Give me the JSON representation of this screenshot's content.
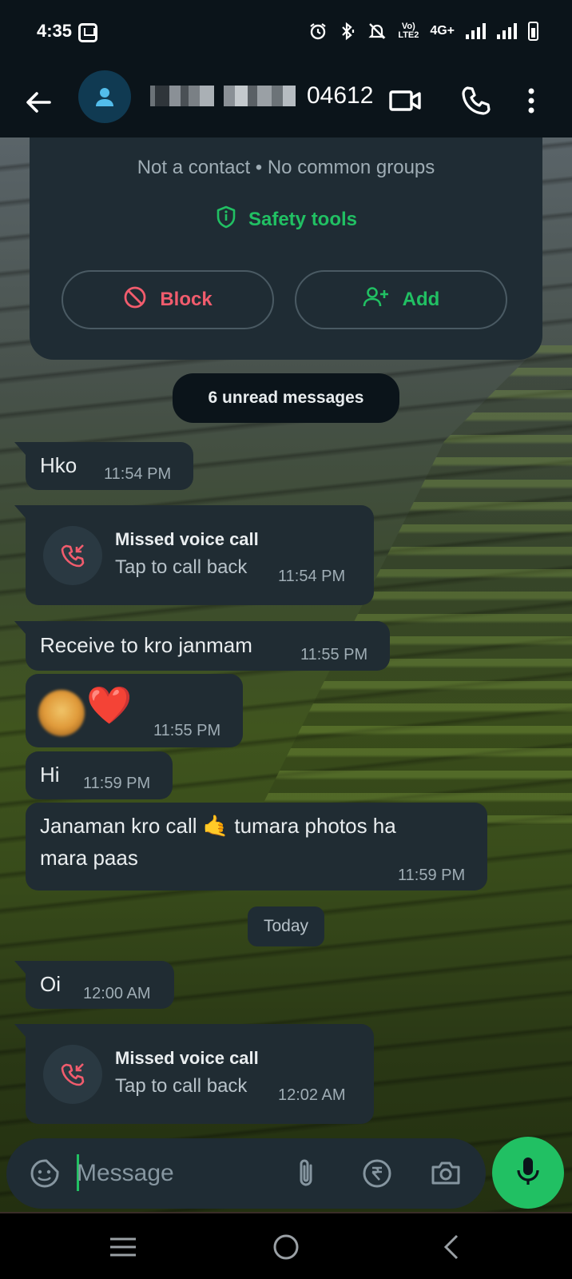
{
  "status_bar": {
    "time": "4:35",
    "network": "4G+",
    "volte": "Vo) LTE2"
  },
  "header": {
    "contact_number_suffix": "04612",
    "contact_number_masked": true
  },
  "contact_card": {
    "subtitle": "Not a contact • No common groups",
    "safety_tools_label": "Safety tools",
    "block_label": "Block",
    "add_label": "Add"
  },
  "unread_chip": "6 unread messages",
  "date_chip": "Today",
  "messages": [
    {
      "type": "text",
      "text": "Hko",
      "time": "11:54 PM"
    },
    {
      "type": "missed_call",
      "title": "Missed voice call",
      "subtitle": "Tap to call back",
      "time": "11:54 PM"
    },
    {
      "type": "text",
      "text": "Receive to kro janmam",
      "time": "11:55 PM"
    },
    {
      "type": "emoji",
      "text": "❤️",
      "time": "11:55 PM"
    },
    {
      "type": "text",
      "text": "Hi",
      "time": "11:59 PM"
    },
    {
      "type": "text",
      "line1": "Janaman kro call 🤙 tumara photos ha",
      "line2": "mara paas",
      "time": "11:59 PM"
    },
    {
      "type": "text",
      "text": "Oi",
      "time": "12:00 AM"
    },
    {
      "type": "missed_call",
      "title": "Missed voice call",
      "subtitle": "Tap to call back",
      "time": "12:02 AM"
    }
  ],
  "composer": {
    "placeholder": "Message"
  },
  "colors": {
    "accent": "#21c063",
    "danger": "#f15c6d",
    "bubble": "#202c33",
    "header": "#0b141a"
  }
}
